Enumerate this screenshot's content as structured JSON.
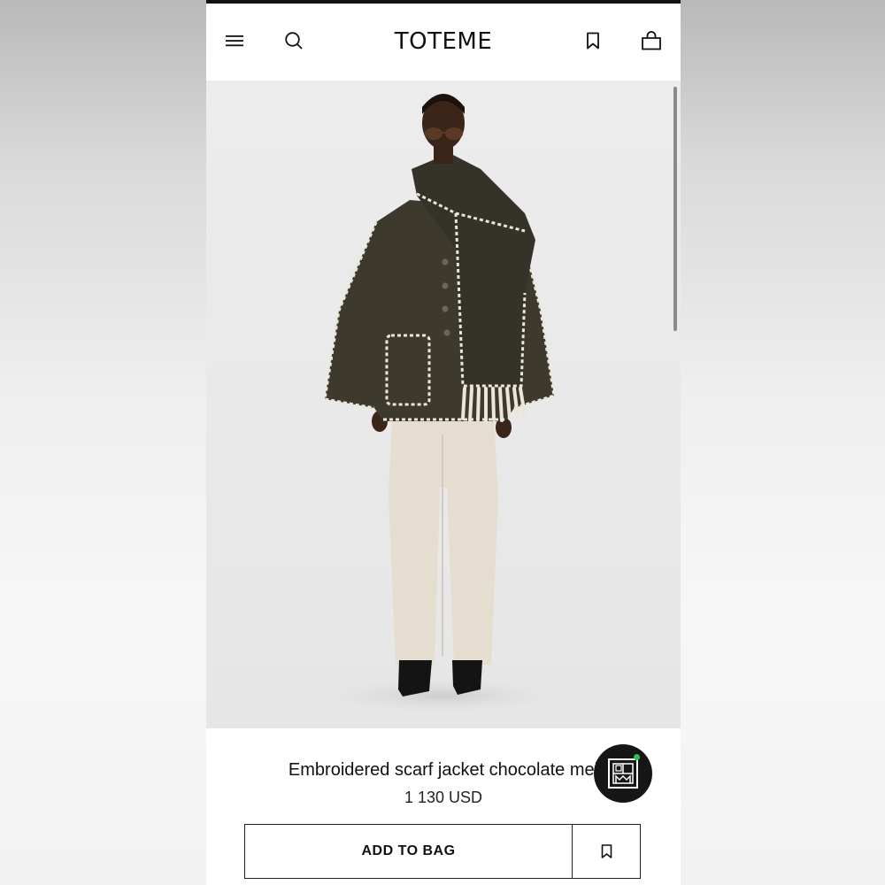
{
  "header": {
    "brand": "TOTEME",
    "menu_icon": "hamburger-menu-icon",
    "search_icon": "search-icon",
    "wishlist_icon": "bookmark-icon",
    "bag_icon": "shopping-bag-icon"
  },
  "product": {
    "title": "Embroidered scarf jacket chocolate mel",
    "price": "1 130 USD",
    "image_alt": "Model wearing a dark brown herringbone jacket with cream blanket-stitch trim, attached fringed scarf, cream straight-leg trousers and black boots"
  },
  "actions": {
    "add_to_bag_label": "ADD TO BAG",
    "save_icon": "bookmark-icon"
  },
  "chat": {
    "icon": "toteme-monogram-icon",
    "status_color": "#2fbf4a"
  },
  "colors": {
    "accent": "#111111",
    "background": "#ffffff",
    "hero_background": "#ebebeb"
  }
}
